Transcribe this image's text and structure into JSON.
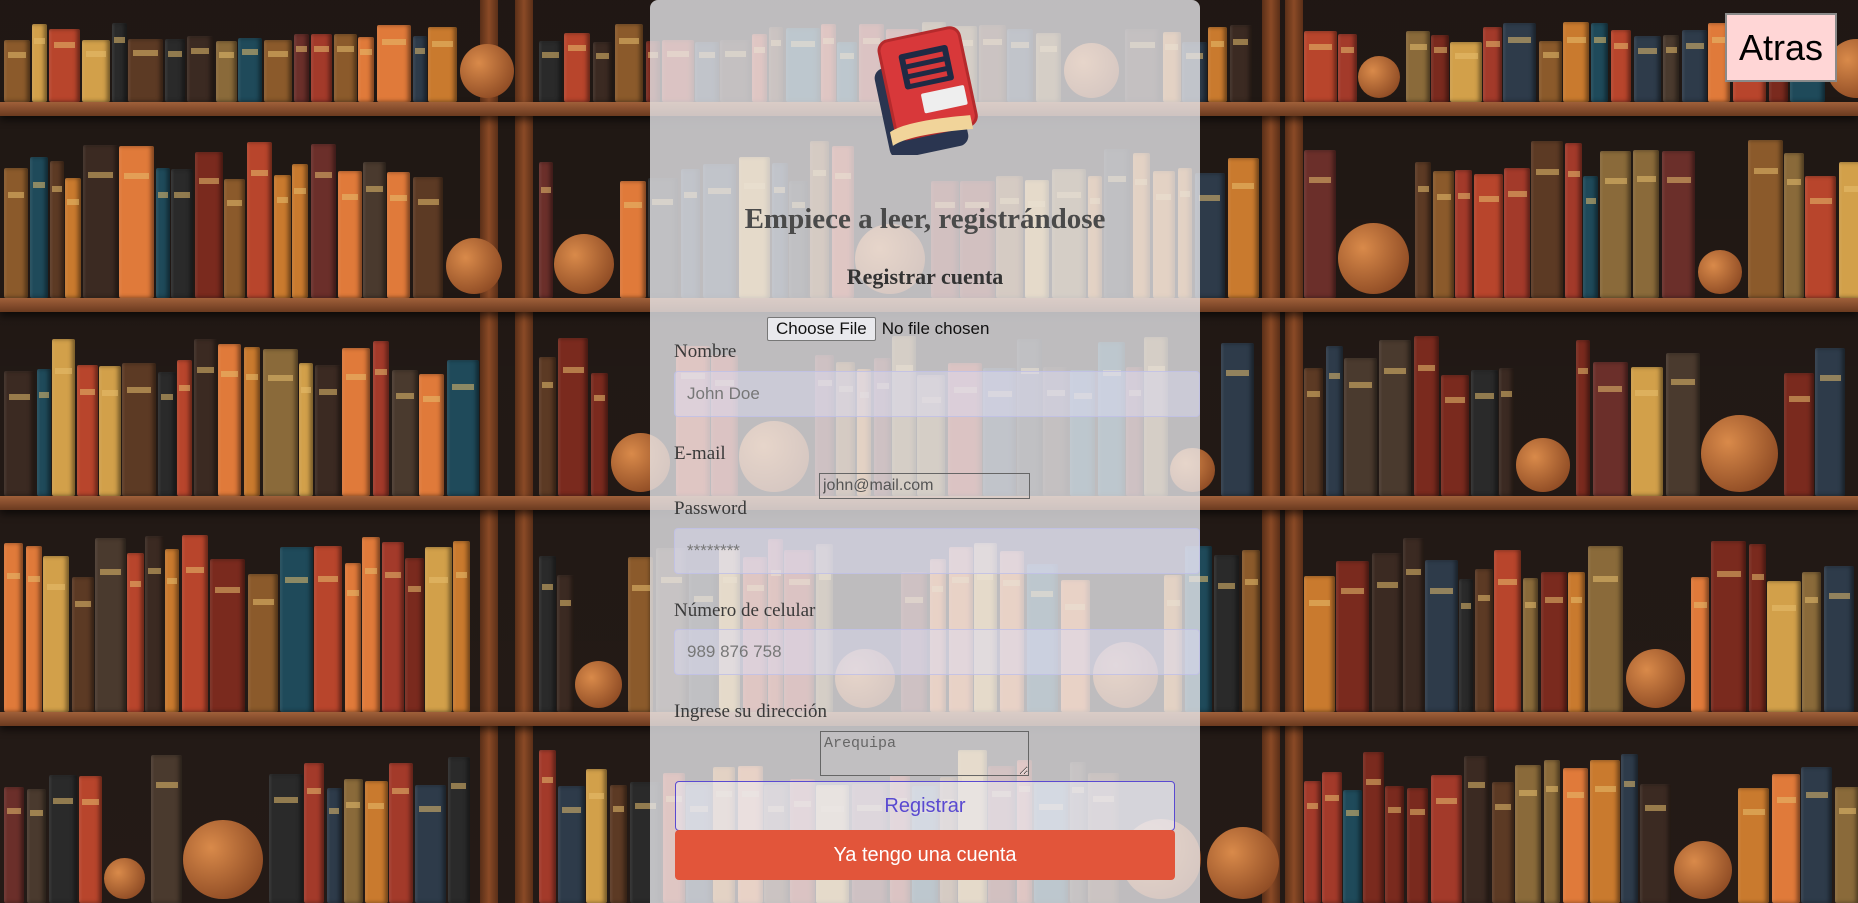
{
  "header": {
    "back_label": "Atras"
  },
  "form": {
    "title": "Empiece a leer, registrándose",
    "subtitle": "Registrar cuenta",
    "file": {
      "button_label": "Choose File",
      "status": "No file chosen"
    },
    "name": {
      "label": "Nombre",
      "placeholder": "John Doe"
    },
    "email": {
      "label": "E-mail",
      "placeholder": "john@mail.com"
    },
    "password": {
      "label": "Password",
      "placeholder": "********"
    },
    "phone": {
      "label": "Número de celular",
      "placeholder": "989 876 758"
    },
    "address": {
      "label": "Ingrese su dirección",
      "placeholder": "Arequipa"
    },
    "register_label": "Registrar",
    "login_label": "Ya tengo una cuenta"
  },
  "icons": {
    "logo": "book-logo-icon"
  },
  "colors": {
    "accent": "#5a4ad1",
    "secondary_button": "#e2553a",
    "back_button_bg": "#ffd6d6",
    "panel_bg": "#ebebee"
  }
}
